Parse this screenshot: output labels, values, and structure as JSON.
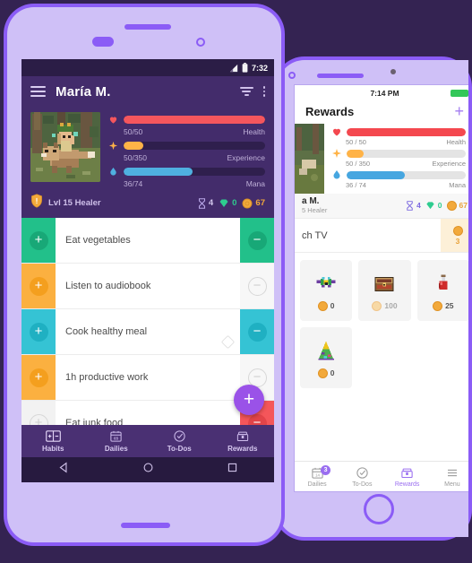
{
  "theme": {
    "background": "#342352",
    "frame": "#8b5cf6",
    "frame_inner": "#cfc0f7",
    "app_purple": "#432c6b",
    "accent": "#9a52e8",
    "health": "#f5565d",
    "experience": "#ffb347",
    "mana": "#4fb0e0",
    "gold": "#f2a93b",
    "gem": "#2ecc8f"
  },
  "left_phone": {
    "status_bar": {
      "time": "7:32",
      "signal_icon": "signal-icon",
      "battery_icon": "battery-icon"
    },
    "app_bar": {
      "menu_icon": "hamburger-icon",
      "title": "María M.",
      "filter_icon": "filter-icon",
      "overflow_icon": "more-vertical-icon"
    },
    "profile": {
      "avatar_name": "character-avatar",
      "bars": [
        {
          "icon": "heart-icon",
          "value": "50/50",
          "label": "Health",
          "percent": 100,
          "color": "#f5565d"
        },
        {
          "icon": "sparkle-icon",
          "value": "50/350",
          "label": "Experience",
          "percent": 14,
          "color": "#ffb347"
        },
        {
          "icon": "mana-drop-icon",
          "value": "36/74",
          "label": "Mana",
          "percent": 49,
          "color": "#4fb0e0"
        }
      ],
      "class_icon": "shield-icon",
      "level_text": "Lvl 15 Healer",
      "stats": [
        {
          "icon": "hourglass-icon",
          "value": "4"
        },
        {
          "icon": "gem-icon",
          "value": "0"
        },
        {
          "icon": "gold-coin-icon",
          "value": "67"
        }
      ]
    },
    "tasks": [
      {
        "label": "Eat vegetables",
        "color": "#22c08a",
        "left_enabled": true,
        "right_enabled": true,
        "tag": false
      },
      {
        "label": "Listen to audiobook",
        "color": "#fbb košy",
        "left_enabled": true,
        "right_enabled": false,
        "tag": false
      },
      {
        "label": "Cook healthy meal",
        "color": "#35c3d4",
        "left_enabled": true,
        "right_enabled": true,
        "tag": true
      },
      {
        "label": "1h productive work",
        "color": "#fbb040",
        "left_enabled": true,
        "right_enabled": false,
        "tag": false
      },
      {
        "label": "Eat junk food",
        "color": "#f4565a",
        "left_enabled": false,
        "right_enabled": true,
        "tag": false
      }
    ],
    "fab_label": "+",
    "tabs": [
      {
        "label": "Habits",
        "icon": "habits-icon",
        "active": true
      },
      {
        "label": "Dailies",
        "icon": "calendar-icon",
        "active": false
      },
      {
        "label": "To-Dos",
        "icon": "check-circle-icon",
        "active": false
      },
      {
        "label": "Rewards",
        "icon": "treasure-icon",
        "active": false
      }
    ],
    "system_nav": [
      {
        "icon": "back-triangle-icon"
      },
      {
        "icon": "home-circle-icon"
      },
      {
        "icon": "recents-square-icon"
      }
    ]
  },
  "right_phone": {
    "status_bar": {
      "time": "7:14 PM",
      "battery_icon": "battery-full-icon"
    },
    "app_bar": {
      "title": "Rewards",
      "add_icon": "plus-icon"
    },
    "profile": {
      "bars": [
        {
          "icon": "heart-icon",
          "value": "50 / 50",
          "label": "Health",
          "percent": 100,
          "color": "#f4484f"
        },
        {
          "icon": "sparkle-icon",
          "value": "50 / 350",
          "label": "Experience",
          "percent": 14,
          "color": "#ffb347"
        },
        {
          "icon": "mana-drop-icon",
          "value": "36 / 74",
          "label": "Mana",
          "percent": 49,
          "color": "#46a6e0"
        }
      ],
      "name": "a M.",
      "level_text": "5 Healer",
      "stats": [
        {
          "icon": "hourglass-icon",
          "value": "4"
        },
        {
          "icon": "gem-icon",
          "value": "0"
        },
        {
          "icon": "gold-coin-icon",
          "value": "67"
        }
      ]
    },
    "custom_reward": {
      "label": "ch TV",
      "cost": "3",
      "cost_icon": "gold-coin-icon"
    },
    "reward_items": [
      {
        "icon": "mask-icon",
        "cost": "0",
        "affordable": true
      },
      {
        "icon": "chest-icon",
        "cost": "100",
        "affordable": false
      },
      {
        "icon": "potion-icon",
        "cost": "25",
        "affordable": true
      },
      {
        "icon": "party-hat-icon",
        "cost": "0",
        "affordable": true
      }
    ],
    "tabs": [
      {
        "label": "Dailies",
        "icon": "calendar-icon",
        "active": false,
        "badge": "3"
      },
      {
        "label": "To-Dos",
        "icon": "check-circle-icon",
        "active": false,
        "badge": ""
      },
      {
        "label": "Rewards",
        "icon": "treasure-icon",
        "active": true,
        "badge": ""
      },
      {
        "label": "Menu",
        "icon": "hamburger-icon",
        "active": false,
        "badge": ""
      }
    ]
  }
}
